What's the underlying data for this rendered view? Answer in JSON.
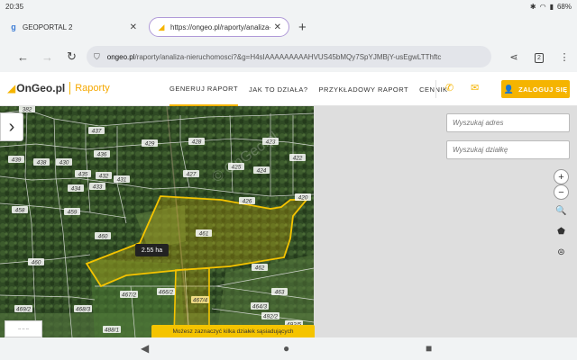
{
  "status": {
    "time": "20:35",
    "battery": "68%"
  },
  "tabs": [
    {
      "title": "GEOPORTAL 2",
      "favicon": "g-favicon-icon"
    },
    {
      "title": "https://ongeo.pl/raporty/analiza-nieruch",
      "favicon": "ongeo-favicon-icon"
    }
  ],
  "toolbar": {
    "url_host": "ongeo.pl",
    "url_path": "/raporty/analiza-nieruchomosci?&g=H4sIAAAAAAAAAHVUS45bMQy7SpYJMBjY-usEgwLTThftc",
    "tab_count": "2"
  },
  "header": {
    "logo_name": "OnGeo.pl",
    "logo_sub": "Raporty",
    "nav": [
      "GENERUJ RAPORT",
      "JAK TO DZIAŁA?",
      "PRZYKŁADOWY RAPORT",
      "CENNIK"
    ],
    "login_label": "ZALOGUJ SIĘ"
  },
  "map": {
    "search_address_placeholder": "Wyszukaj adres",
    "search_parcel_placeholder": "Wyszukaj działkę",
    "area_label": "2.55 ha",
    "hint": "Możesz zaznaczyć kilka działek sąsiadujących",
    "watermark": "© OnGeo.pl",
    "parcels": [
      {
        "id": "382"
      },
      {
        "id": "437"
      },
      {
        "id": "429"
      },
      {
        "id": "428"
      },
      {
        "id": "423"
      },
      {
        "id": "436"
      },
      {
        "id": "422"
      },
      {
        "id": "439"
      },
      {
        "id": "438"
      },
      {
        "id": "430"
      },
      {
        "id": "425"
      },
      {
        "id": "424"
      },
      {
        "id": "435"
      },
      {
        "id": "432"
      },
      {
        "id": "431"
      },
      {
        "id": "427"
      },
      {
        "id": "434"
      },
      {
        "id": "433"
      },
      {
        "id": "426"
      },
      {
        "id": "420"
      },
      {
        "id": "458"
      },
      {
        "id": "459"
      },
      {
        "id": "461"
      },
      {
        "id": "460"
      },
      {
        "id": "460"
      },
      {
        "id": "462"
      },
      {
        "id": "467/2"
      },
      {
        "id": "466/2"
      },
      {
        "id": "463"
      },
      {
        "id": "469/2"
      },
      {
        "id": "468/3"
      },
      {
        "id": "467/4"
      },
      {
        "id": "464/3"
      },
      {
        "id": "492/2"
      },
      {
        "id": "488/1"
      },
      {
        "id": "492/5"
      }
    ]
  },
  "colors": {
    "accent": "#f5b400",
    "selection": "#f5c400"
  }
}
